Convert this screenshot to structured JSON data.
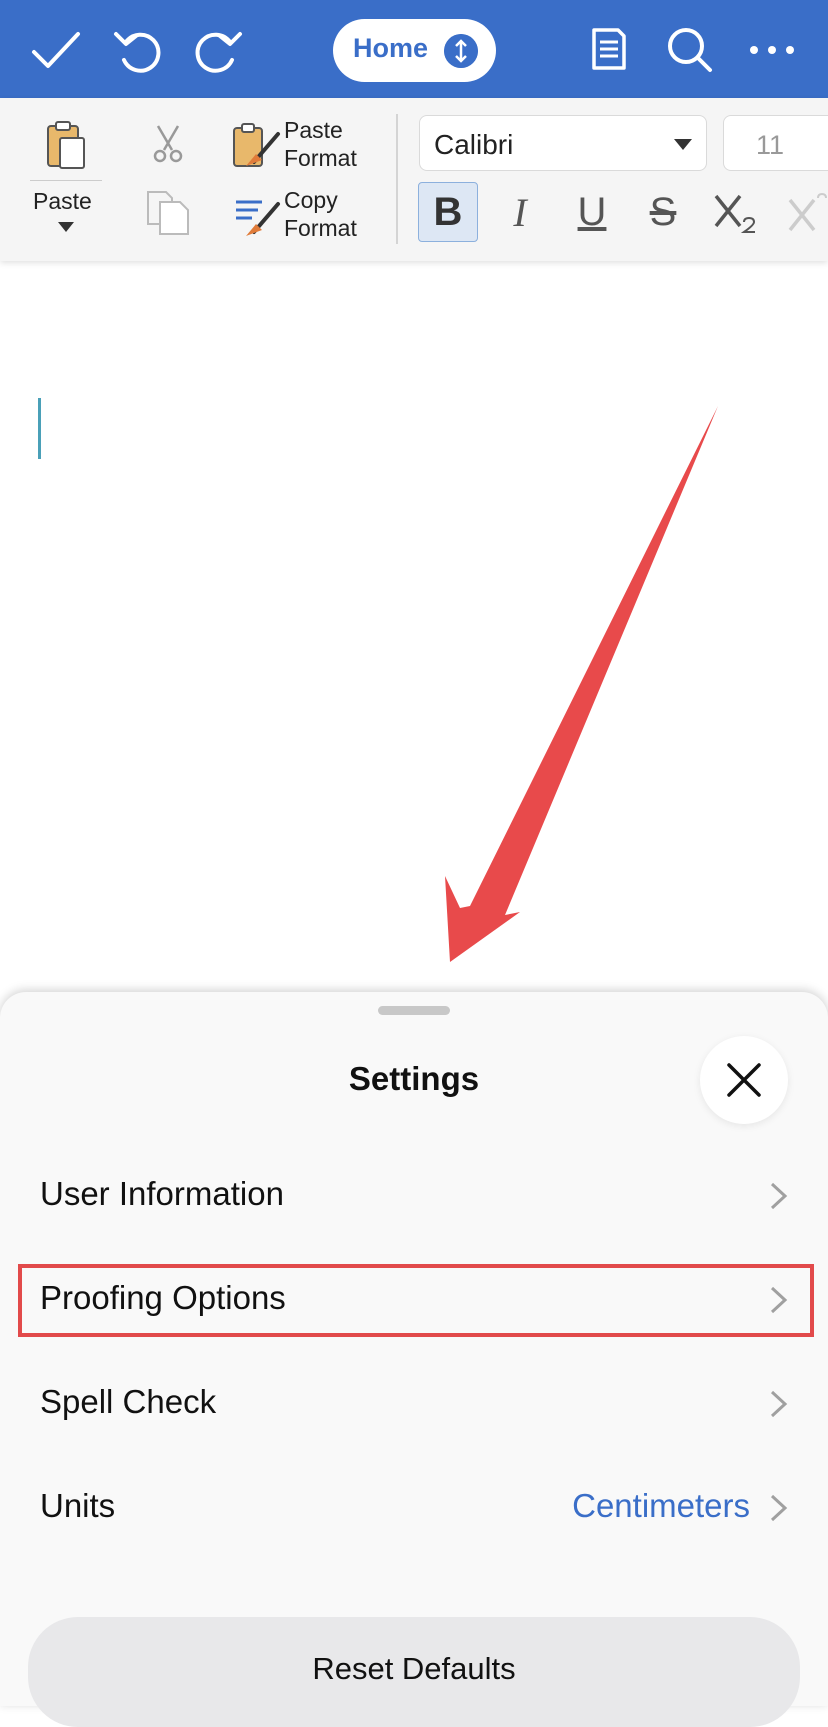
{
  "topbar": {
    "home_label": "Home"
  },
  "ribbon": {
    "paste_label": "Paste",
    "paste_format_line1": "Paste",
    "paste_format_line2": "Format",
    "copy_format_line1": "Copy",
    "copy_format_line2": "Format",
    "font_name": "Calibri",
    "font_size": "11",
    "bold": "B",
    "italic": "I",
    "underline": "U",
    "strike": "S"
  },
  "settings": {
    "title": "Settings",
    "rows": [
      {
        "label": "User Information",
        "value": ""
      },
      {
        "label": "Proofing Options",
        "value": ""
      },
      {
        "label": "Spell Check",
        "value": ""
      },
      {
        "label": "Units",
        "value": "Centimeters"
      }
    ],
    "reset_label": "Reset Defaults"
  },
  "colors": {
    "brand": "#3a6ec8",
    "highlight": "#e24a4b"
  }
}
